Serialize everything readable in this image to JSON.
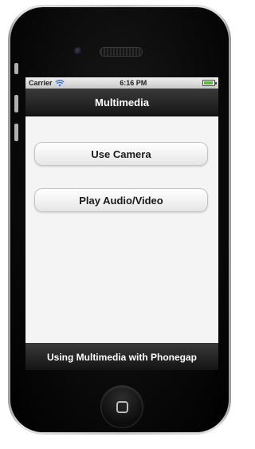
{
  "status_bar": {
    "carrier": "Carrier",
    "time": "6:16 PM",
    "wifi_icon": "wifi-icon",
    "battery_icon": "battery-icon",
    "battery_level": 0.9,
    "battery_color": "#5ab83a"
  },
  "nav": {
    "title": "Multimedia"
  },
  "main": {
    "buttons": [
      {
        "label": "Use Camera"
      },
      {
        "label": "Play Audio/Video"
      }
    ]
  },
  "footer": {
    "text": "Using Multimedia with Phonegap"
  },
  "device": {
    "home_icon": "home-button-icon",
    "camera_icon": "front-camera-icon",
    "speaker_icon": "earpiece-speaker-icon"
  }
}
